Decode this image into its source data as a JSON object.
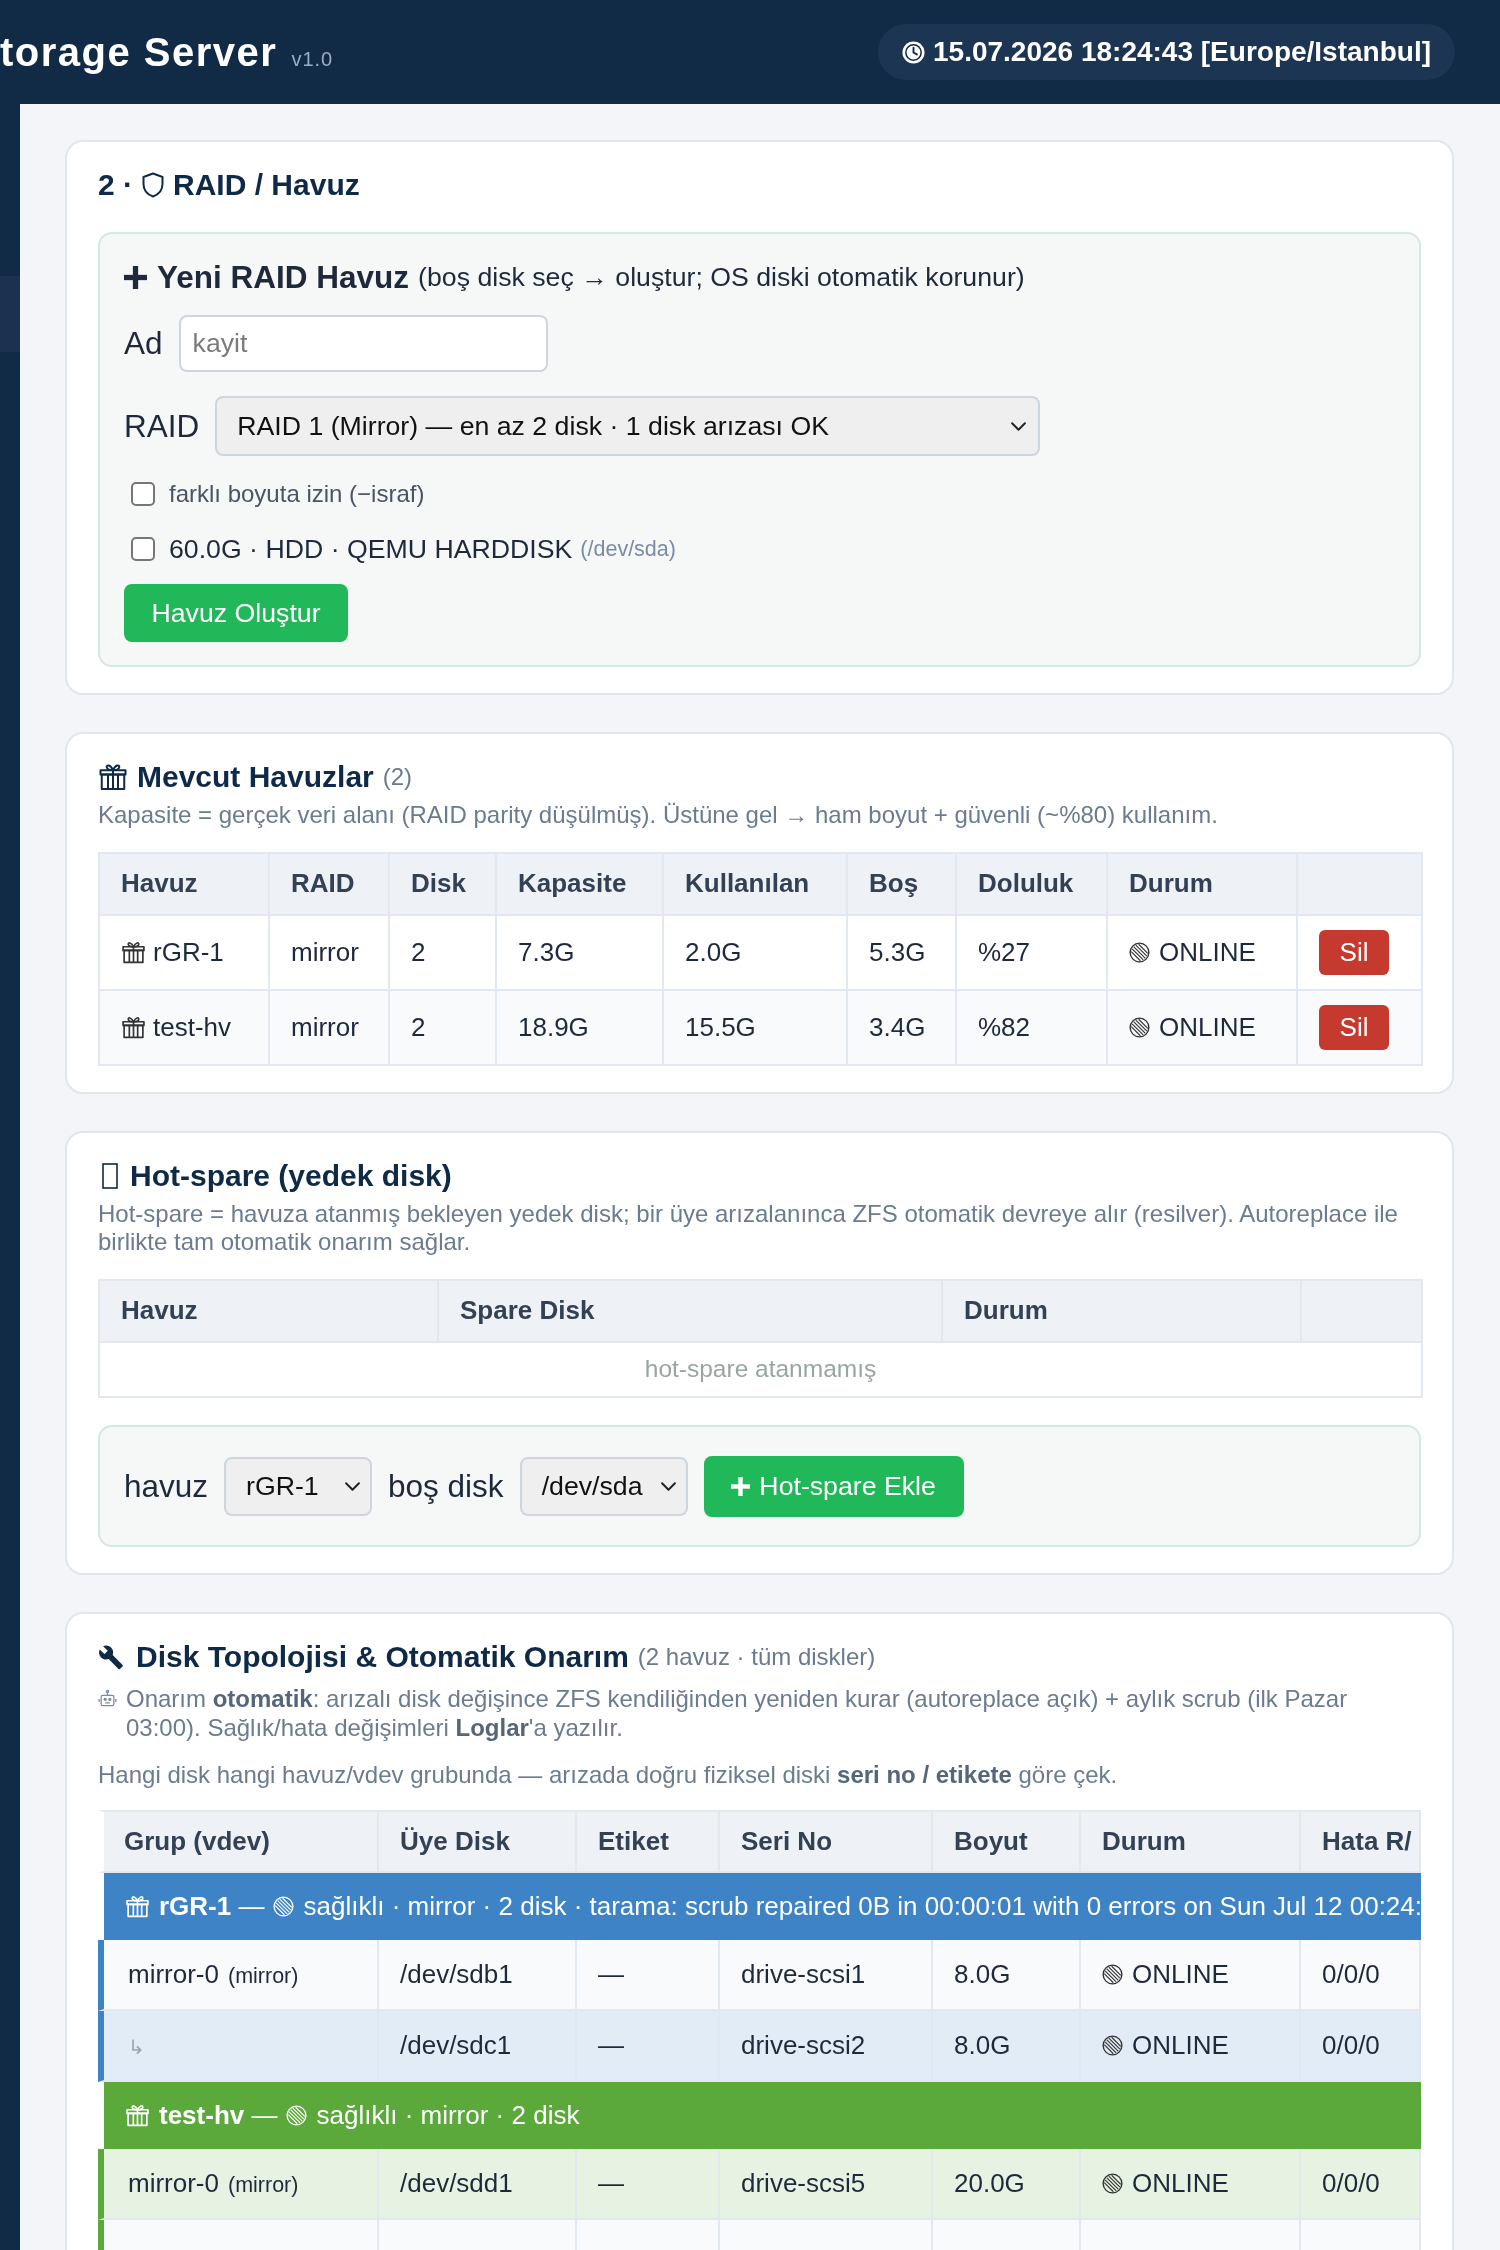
{
  "header": {
    "title": "torage Server",
    "version": "v1.0",
    "clock": "15.07.2026 18:24:43 [Europe/Istanbul]"
  },
  "raid": {
    "prefix": "2 ·",
    "title": "RAID / Havuz",
    "new_pool": {
      "title": "Yeni RAID Havuz",
      "subtitle": "(boş disk seç → oluştur; OS diski otomatik korunur)",
      "name_field": {
        "label": "Ad",
        "placeholder": "kayit"
      },
      "raid_select": {
        "label": "RAID",
        "value": "RAID 1 (Mirror) — en az 2 disk · 1 disk arızası OK"
      },
      "options": [
        {
          "kind": "setting",
          "label": "farklı boyuta izin (−israf)",
          "checked": false
        },
        {
          "kind": "disk",
          "label": "60.0G · HDD · QEMU HARDDISK",
          "device": "(/dev/sda)",
          "checked": false
        }
      ],
      "create_button": "Havuz Oluştur"
    }
  },
  "pools": {
    "title": "Mevcut Havuzlar",
    "count": "(2)",
    "description": "Kapasite = gerçek veri alanı (RAID parity düşülmüş). Üstüne gel → ham boyut + güvenli (~%80) kullanım.",
    "table": {
      "columns": [
        "Havuz",
        "RAID",
        "Disk",
        "Kapasite",
        "Kullanılan",
        "Boş",
        "Doluluk",
        "Durum"
      ],
      "rows": [
        {
          "name": "rGR-1",
          "raid": "mirror",
          "disks": "2",
          "capacity": "7.3G",
          "used": "2.0G",
          "free": "5.3G",
          "fill": "%27",
          "status": "ONLINE",
          "delete_button": "Sil"
        },
        {
          "name": "test-hv",
          "raid": "mirror",
          "disks": "2",
          "capacity": "18.9G",
          "used": "15.5G",
          "free": "3.4G",
          "fill": "%82",
          "status": "ONLINE",
          "delete_button": "Sil"
        }
      ]
    }
  },
  "hot_spare": {
    "title": "Hot-spare (yedek disk)",
    "description": "Hot-spare = havuza atanmış bekleyen yedek disk; bir üye arızalanınca ZFS otomatik devreye alır (resilver). Autoreplace ile birlikte tam otomatik onarım sağlar.",
    "table": {
      "columns": [
        "Havuz",
        "Spare Disk",
        "Durum"
      ],
      "empty_message": "hot-spare atanmamış"
    },
    "form": {
      "pool_label": "havuz",
      "pool_select": "rGR-1",
      "disk_label": "boş disk",
      "disk_select": "/dev/sda",
      "add_button": "Hot-spare Ekle"
    }
  },
  "topology": {
    "title": "Disk Topolojisi & Otomatik Onarım",
    "subtitle": "(2 havuz · tüm diskler)",
    "note": "Onarım **otomatik**: arızalı disk değişince ZFS kendiliğinden yeniden kurar (autoreplace açık) + aylık scrub (ilk Pazar 03:00). Sağlık/hata değişimleri **Loglar**'a yazılır.",
    "hint": "Hangi disk hangi havuz/vdev grubunda — arızada doğru fiziksel diski **seri no / etikete** göre çek.",
    "table": {
      "columns": [
        "Grup (vdev)",
        "Üye Disk",
        "Etiket",
        "Seri No",
        "Boyut",
        "Durum",
        "Hata R/"
      ],
      "groups": [
        {
          "title": "**rGR-1** —",
          "summary": "sağlıklı · mirror · 2 disk · tarama: scrub repaired 0B in 00:00:01 with 0 errors on Sun Jul 12 00:24:",
          "color": "#3d83c5",
          "rows": [
            {
              "kind": "vdev",
              "group": "mirror-0",
              "type": "(mirror)",
              "disk": "/dev/sdb1",
              "label": "—",
              "serial": "drive-scsi1",
              "size": "8.0G",
              "status": "ONLINE",
              "errors": "0/0/0"
            },
            {
              "kind": "member",
              "group": "↳",
              "disk": "/dev/sdc1",
              "label": "—",
              "serial": "drive-scsi2",
              "size": "8.0G",
              "status": "ONLINE",
              "errors": "0/0/0"
            }
          ]
        },
        {
          "title": "**test-hv** —",
          "summary": "sağlıklı · mirror · 2 disk",
          "color": "#5ba83b",
          "rows": [
            {
              "kind": "vdev",
              "group": "mirror-0",
              "type": "(mirror)",
              "disk": "/dev/sdd1",
              "label": "—",
              "serial": "drive-scsi5",
              "size": "20.0G",
              "status": "ONLINE",
              "errors": "0/0/0"
            }
          ]
        }
      ]
    }
  }
}
